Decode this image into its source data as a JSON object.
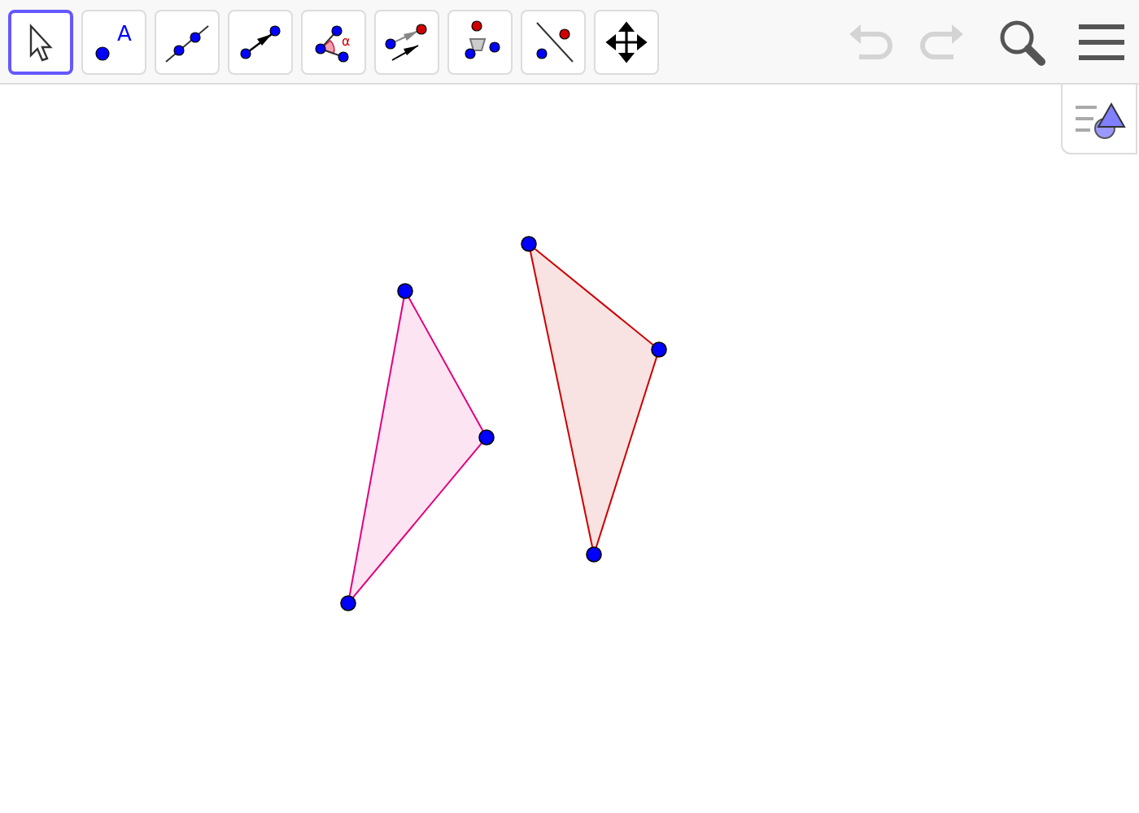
{
  "toolbar": {
    "tools": [
      {
        "kind": "move",
        "selected": true
      },
      {
        "kind": "point",
        "label": "A",
        "selected": false
      },
      {
        "kind": "line",
        "selected": false
      },
      {
        "kind": "vector",
        "selected": false
      },
      {
        "kind": "angle",
        "label": "α",
        "selected": false
      },
      {
        "kind": "parallel-vector",
        "selected": false
      },
      {
        "kind": "rotate",
        "selected": false
      },
      {
        "kind": "reflect",
        "selected": false
      },
      {
        "kind": "move-view",
        "selected": false
      }
    ],
    "undo": {
      "disabled": true
    },
    "redo": {
      "disabled": true
    }
  },
  "canvas": {
    "polygons": [
      {
        "color": "#e0007f"
      },
      {
        "color": "#cc0000"
      }
    ]
  }
}
